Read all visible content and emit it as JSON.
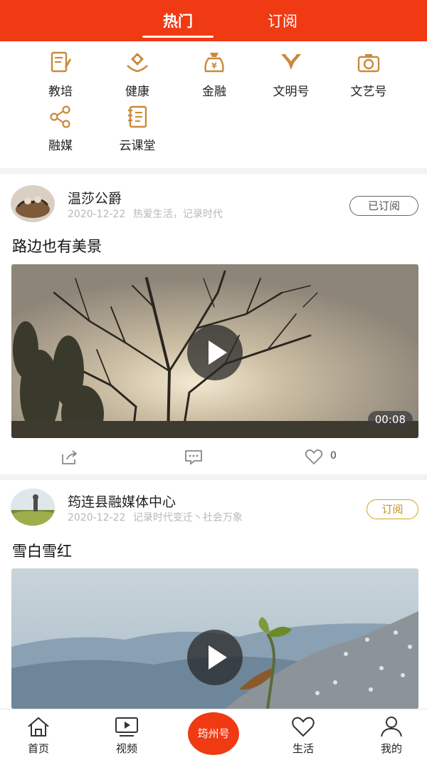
{
  "tabs": {
    "hot": "热门",
    "subscribe": "订阅"
  },
  "categories": [
    {
      "label": "教培",
      "icon": "teaching-icon"
    },
    {
      "label": "健康",
      "icon": "health-icon"
    },
    {
      "label": "金融",
      "icon": "finance-icon"
    },
    {
      "label": "文明号",
      "icon": "civilization-icon"
    },
    {
      "label": "文艺号",
      "icon": "camera-icon"
    },
    {
      "label": "融媒",
      "icon": "share-icon"
    },
    {
      "label": "云课堂",
      "icon": "notebook-icon"
    }
  ],
  "posts": [
    {
      "author": "温莎公爵",
      "date": "2020-12-22",
      "tags": "热爱生活，记录时代",
      "sub_label": "已订阅",
      "title": "路边也有美景",
      "duration": "00:08",
      "likes": "0"
    },
    {
      "author": "筠连县融媒体中心",
      "date": "2020-12-22",
      "tags": "记录时代变迁丶社会万象",
      "sub_label": "订阅",
      "title": "雪白雪红"
    }
  ],
  "nav": {
    "home": "首页",
    "video": "视频",
    "center": "筠州号",
    "life": "生活",
    "mine": "我的"
  },
  "colors": {
    "brand": "#f03a14",
    "subscribe_gold": "#c8931a",
    "icon_gold": "#c98a3a"
  }
}
